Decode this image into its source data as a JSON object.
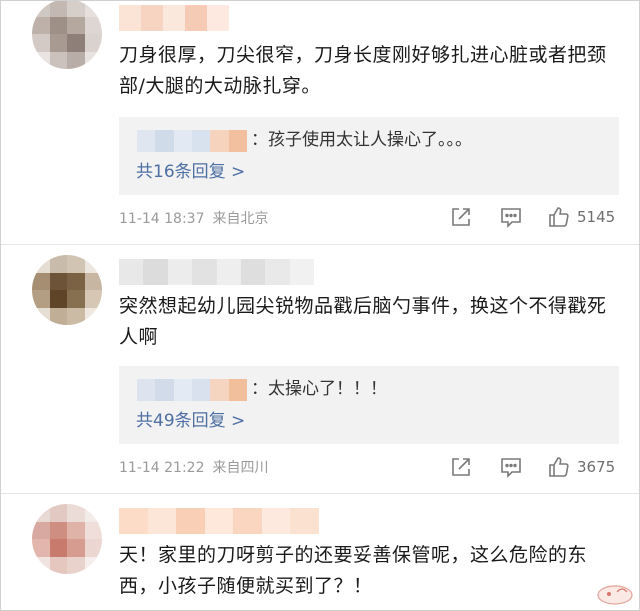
{
  "comments": [
    {
      "text": "刀身很厚，刀尖很窄，刀身长度刚好够扎进心脏或者把颈部/大腿的大动脉扎穿。",
      "reply": {
        "text": "：孩子使用太让人操心了。。。",
        "count_label": "共16条回复 >"
      },
      "time": "11-14 18:37",
      "location": "来自北京",
      "likes": "5145"
    },
    {
      "text": "突然想起幼儿园尖锐物品戳后脑勺事件，换这个不得戳死人啊",
      "reply": {
        "text": "：太操心了！！！",
        "count_label": "共49条回复 >"
      },
      "time": "11-14 21:22",
      "location": "来自四川",
      "likes": "3675"
    },
    {
      "text": "天！家里的刀呀剪子的还要妥善保管呢，这么危险的东西，小孩子随便就买到了？！"
    }
  ],
  "colors": {
    "link": "#4e6fa3",
    "meta": "#9a9a9a",
    "reply_bg": "#f2f2f2"
  },
  "icons": [
    "share-icon",
    "comment-icon",
    "thumbs-up-icon"
  ]
}
